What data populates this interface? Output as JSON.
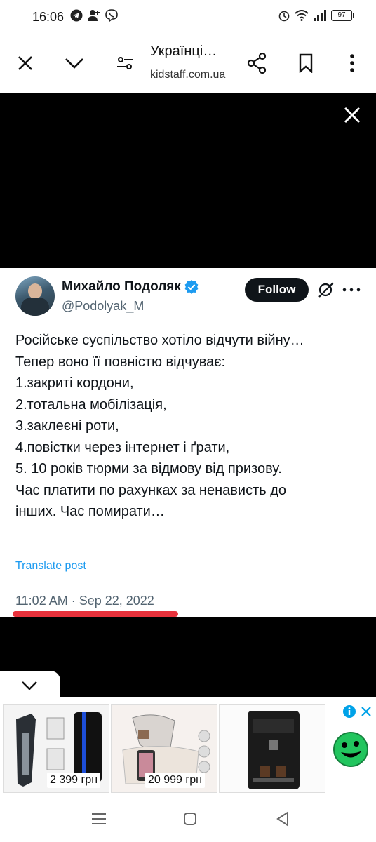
{
  "status_bar": {
    "time": "16:06",
    "battery": "97",
    "left_icons": [
      "telegram-icon",
      "add-person-icon",
      "viber-icon"
    ],
    "right_icons": [
      "alarm-icon",
      "wifi-icon",
      "signal-icon",
      "battery-icon"
    ]
  },
  "toolbar": {
    "title": "Українці…",
    "url": "kidstaff.com.ua",
    "icons": [
      "close-icon",
      "chevron-down-icon",
      "tune-icon",
      "share-icon",
      "bookmark-icon",
      "more-vert-icon"
    ]
  },
  "tweet": {
    "author_name": "Михайло Подоляк",
    "handle": "@Podolyak_M",
    "follow_label": "Follow",
    "lines": [
      "Російське суспільство хотіло відчути війну…",
      "Тепер воно її повністю відчуває:",
      "",
      "1.закриті кордони,",
      "2.тотальна мобілізація,",
      "3.заклеєні роти,",
      "4.повістки через інтернет і ґрати,",
      "5. 10 років тюрми за відмову від призову.",
      "Час платити по рахунках за ненависть до",
      "інших. Час помирати…"
    ],
    "translate_label": "Translate post",
    "timestamp": "11:02 AM · Sep 22, 2022"
  },
  "ads": {
    "items": [
      {
        "price": "2 399 грн"
      },
      {
        "price": "20 999 грн"
      },
      {
        "price": ""
      }
    ]
  },
  "colors": {
    "accent_blue": "#1d9bf0",
    "highlight_red": "#e8323c",
    "follow_bg": "#0f1419"
  }
}
